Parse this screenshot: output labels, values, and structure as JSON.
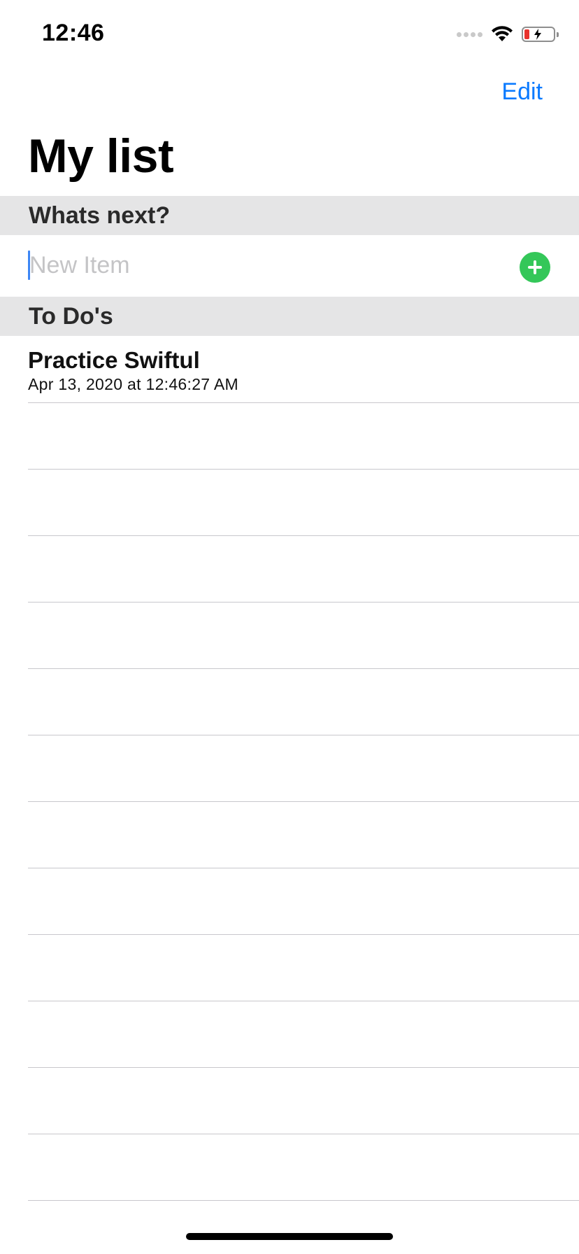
{
  "status_bar": {
    "time": "12:46",
    "icons": [
      "signal-dots-icon",
      "wifi-icon",
      "battery-charging-icon"
    ],
    "battery_color": "#e8322d"
  },
  "nav": {
    "edit_label": "Edit",
    "title": "My list"
  },
  "sections": {
    "next_header": "Whats next?",
    "todo_header": "To Do's"
  },
  "new_item": {
    "value": "",
    "placeholder": "New Item",
    "add_icon": "plus-circle-icon",
    "add_color": "#34c759"
  },
  "todos": [
    {
      "title": "Practice Swiftul",
      "date": "Apr 13, 2020 at 12:46:27 AM"
    }
  ],
  "colors": {
    "accent": "#0a7aff",
    "section_bg": "#e5e5e6",
    "separator": "#c8c7cc"
  }
}
